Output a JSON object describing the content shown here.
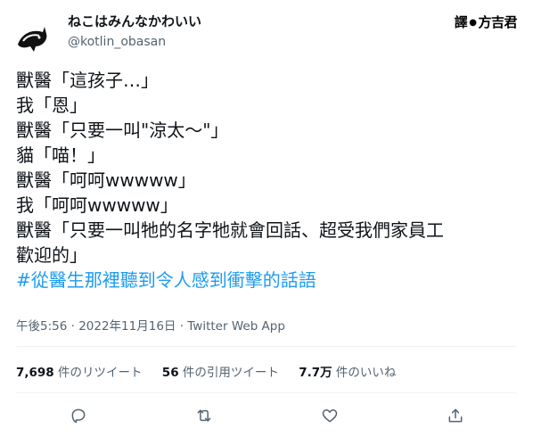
{
  "user": {
    "display_name": "ねこはみんなかわいい",
    "handle": "@kotlin_obasan"
  },
  "watermark": {
    "prefix": "譯",
    "separator": "●",
    "name": "方吉君"
  },
  "tweet": {
    "lines": [
      "獸醫「這孩子…」",
      "我「恩」",
      "獸醫「只要一叫\"涼太～\"」",
      "貓「喵！」",
      "獸醫「呵呵wwwww」",
      "我「呵呵wwwww」",
      "獸醫「只要一叫牠的名字牠就會回話、超受我們家員工",
      "歡迎的」"
    ],
    "hashtag": "#從醫生那裡聽到令人感到衝擊的話語"
  },
  "meta": {
    "time": "午後5:56",
    "sep1": " · ",
    "date": "2022年11月16日",
    "sep2": " · ",
    "client": "Twitter Web App"
  },
  "stats": {
    "retweets_count": "7,698",
    "retweets_label": " 件のリツイート",
    "quotes_count": "56",
    "quotes_label": " 件の引用ツイート",
    "likes_count": "7.7万",
    "likes_label": " 件のいいね"
  },
  "actions": {
    "reply": "reply-icon",
    "retweet": "retweet-icon",
    "like": "heart-icon",
    "share": "share-icon"
  }
}
